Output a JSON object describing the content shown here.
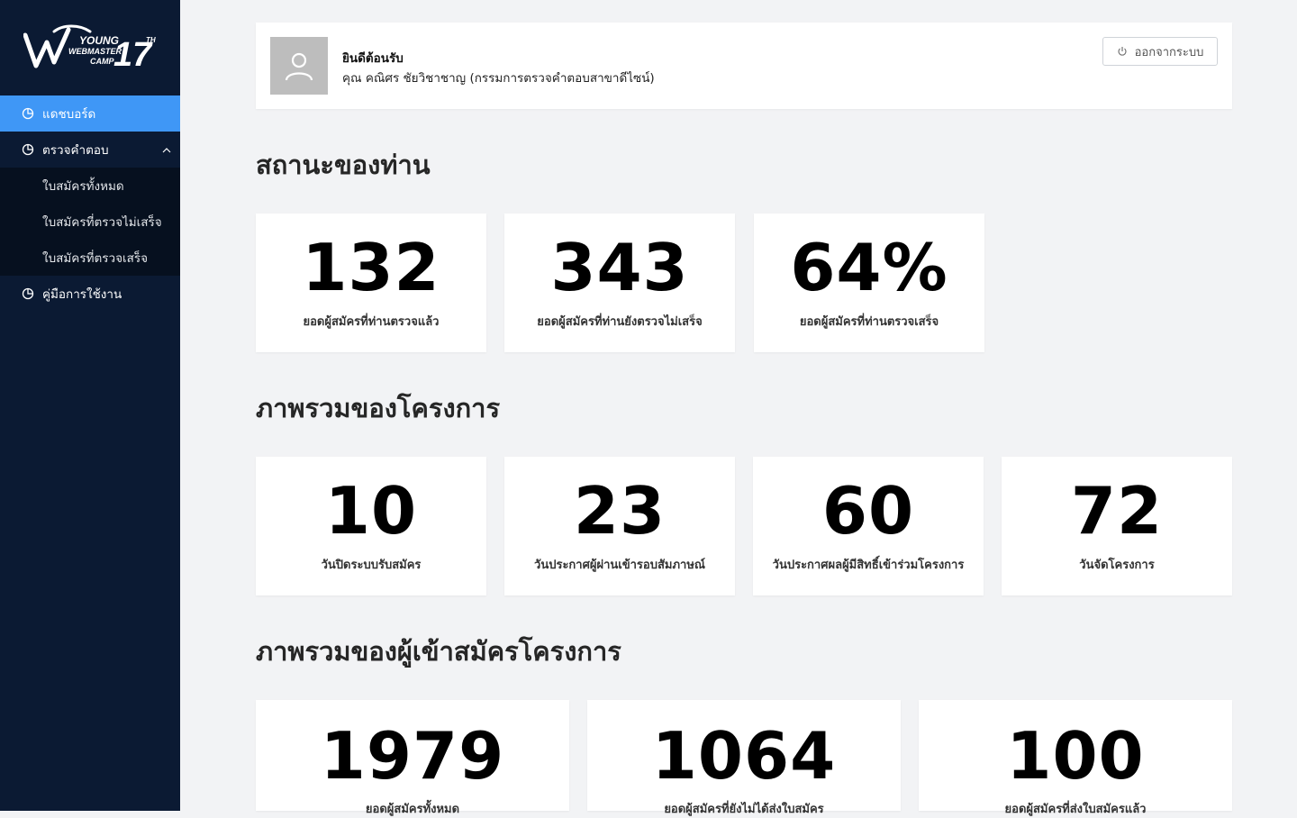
{
  "brand": {
    "logo_alt": "Young Webmaster Camp 17th logo",
    "accent": "#3f97f6",
    "sidebar_bg": "#0b1a33"
  },
  "sidebar": {
    "items": [
      {
        "label": "แดชบอร์ด",
        "icon": "pie-chart-icon",
        "active": true
      },
      {
        "label": "ตรวจคำตอบ",
        "icon": "pie-chart-icon",
        "expanded": true,
        "children": [
          {
            "label": "ใบสมัครทั้งหมด"
          },
          {
            "label": "ใบสมัครที่ตรวจไม่เสร็จ"
          },
          {
            "label": "ใบสมัครที่ตรวจเสร็จ"
          }
        ]
      },
      {
        "label": "คู่มือการใช้งาน",
        "icon": "pie-chart-icon"
      }
    ]
  },
  "header": {
    "welcome_title": "ยินดีต้อนรับ",
    "welcome_name": "คุณ คณิศร  ชัยวิชาชาญ (กรรมการตรวจคำตอบสาขาดีไซน์)",
    "logout_label": "ออกจากระบบ"
  },
  "status": {
    "title": "สถานะของท่าน",
    "cards": [
      {
        "value": "132",
        "label": "ยอดผู้สมัครที่ท่านตรวจแล้ว"
      },
      {
        "value": "343",
        "label": "ยอดผู้สมัครที่ท่านยังตรวจไม่เสร็จ"
      },
      {
        "value": "64%",
        "label": "ยอดผู้สมัครที่ท่านตรวจเสร็จ"
      }
    ]
  },
  "project": {
    "title": "ภาพรวมของโครงการ",
    "cards": [
      {
        "value": "10",
        "label": "วันปิดระบบรับสมัคร"
      },
      {
        "value": "23",
        "label": "วันประกาศผู้ผ่านเข้ารอบสัมภาษณ์"
      },
      {
        "value": "60",
        "label": "วันประกาศผลผู้มีสิทธิ์เข้าร่วมโครงการ"
      },
      {
        "value": "72",
        "label": "วันจัดโครงการ"
      }
    ]
  },
  "applicants": {
    "title": "ภาพรวมของผู้เข้าสมัครโครงการ",
    "cards": [
      {
        "value": "1979",
        "label": "ยอดผู้สมัครทั้งหมด"
      },
      {
        "value": "1064",
        "label": "ยอดผู้สมัครที่ยังไม่ได้ส่งใบสมัคร"
      },
      {
        "value": "100",
        "label": "ยอดผู้สมัครที่ส่งใบสมัครแล้ว"
      }
    ]
  }
}
